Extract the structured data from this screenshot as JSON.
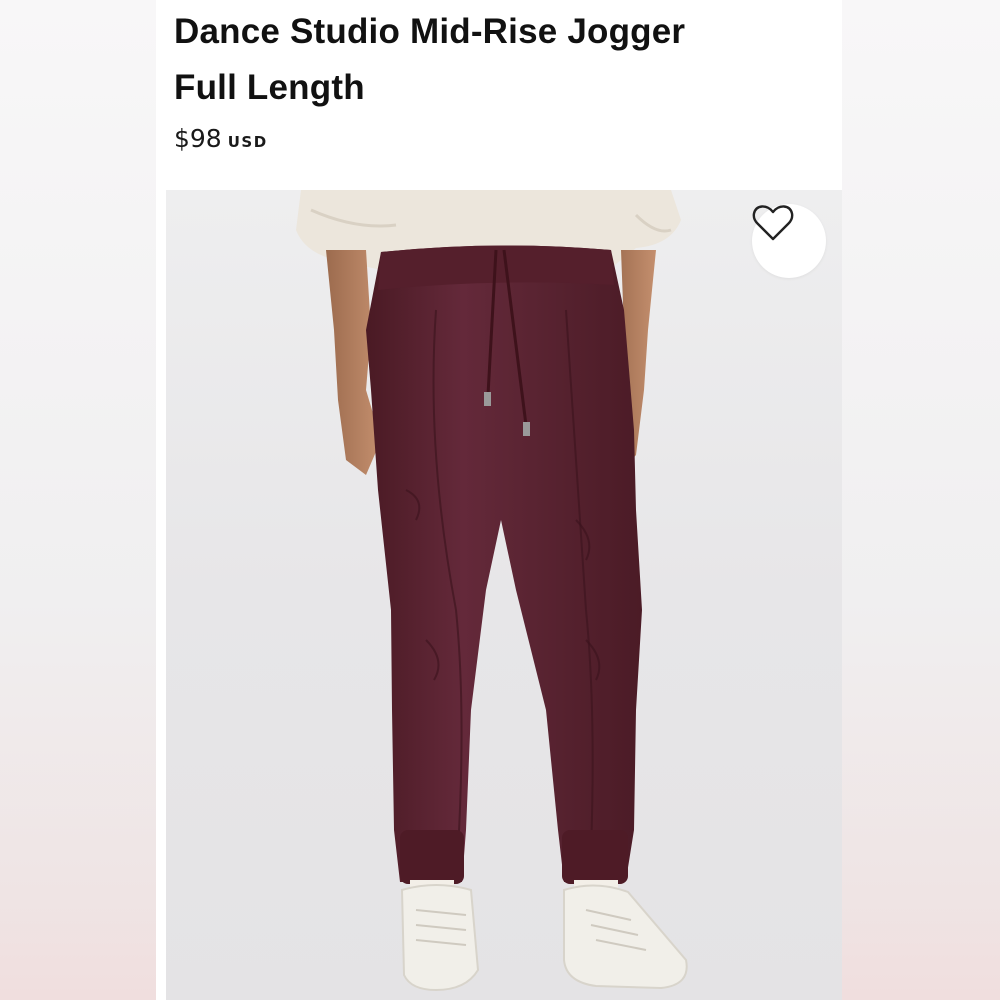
{
  "product": {
    "title_line1": "Dance Studio Mid-Rise Jogger",
    "title_line2": "Full Length",
    "price": "$98",
    "currency": "USD"
  },
  "image": {
    "description_icon": "wishlist-heart-icon",
    "pant_color": "#5c2530",
    "sweater_color": "#ece6dc",
    "shoe_color": "#f1efe9"
  }
}
